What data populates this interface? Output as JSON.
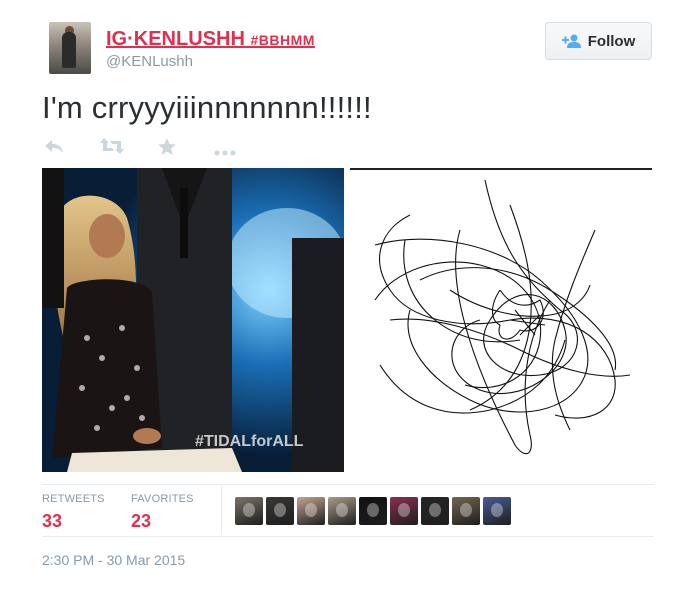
{
  "user": {
    "display_name": "IG·KENLUSHH",
    "display_tag": "#BBHMM",
    "handle": "@KENLushh",
    "avatar_icon": "profile-photo"
  },
  "follow_button": {
    "label": "Follow",
    "icon": "add-person-icon"
  },
  "tweet": {
    "text": "I'm crryyyiiinnnnnnn!!!!!!"
  },
  "actions": [
    {
      "name": "reply-icon"
    },
    {
      "name": "retweet-icon"
    },
    {
      "name": "favorite-icon"
    },
    {
      "name": "more-icon"
    }
  ],
  "media": {
    "left_watermark": "#TIDALforALL",
    "left_description_icon": "photo-thumbnail",
    "right_description_icon": "scribble-drawing"
  },
  "stats": {
    "retweets_label": "RETWEETS",
    "retweets_count": "33",
    "favorites_label": "FAVORITES",
    "favorites_count": "23"
  },
  "favoriters": [
    {
      "color": "#7d7468"
    },
    {
      "color": "#3a3635"
    },
    {
      "color": "#c6a690"
    },
    {
      "color": "#a99c88"
    },
    {
      "color": "#101010"
    },
    {
      "color": "#8a2f52"
    },
    {
      "color": "#262626"
    },
    {
      "color": "#74674f"
    },
    {
      "color": "#4a5c9a"
    }
  ],
  "timestamp": "2:30 PM - 30 Mar 2015",
  "colors": {
    "accent": "#e0304f",
    "muted": "#8899a6",
    "text": "#292f33"
  }
}
